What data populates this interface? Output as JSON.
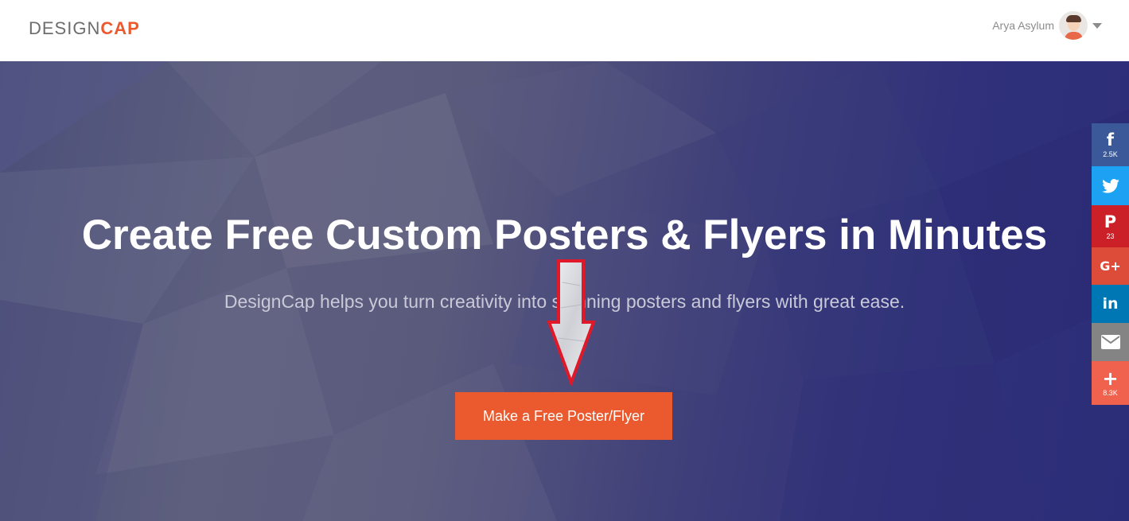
{
  "header": {
    "logo_part1": "DESIGN",
    "logo_part2": "CAP",
    "user_name": "Arya Asylum"
  },
  "hero": {
    "title": "Create Free Custom Posters & Flyers in Minutes",
    "subtitle": "DesignCap helps you turn creativity into stunning posters and flyers with great ease.",
    "cta_label": "Make a Free Poster/Flyer"
  },
  "social": [
    {
      "name": "facebook",
      "glyph": "f",
      "count": "2.5K",
      "color": "#3b5998"
    },
    {
      "name": "twitter",
      "glyph": "",
      "count": "",
      "color": "#1da1f2"
    },
    {
      "name": "pinterest",
      "glyph": "P",
      "count": "23",
      "color": "#cb2027"
    },
    {
      "name": "google-plus",
      "glyph": "G+",
      "count": "",
      "color": "#dd4b39"
    },
    {
      "name": "linkedin",
      "glyph": "in",
      "count": "",
      "color": "#0077b5"
    },
    {
      "name": "email",
      "glyph": "",
      "count": "",
      "color": "#848484"
    },
    {
      "name": "more",
      "glyph": "+",
      "count": "8.3K",
      "color": "#f0624d"
    }
  ],
  "colors": {
    "brand_orange": "#ea5a2e",
    "hero_dark": "#2c2d78",
    "annotation_red": "#e0192a"
  }
}
